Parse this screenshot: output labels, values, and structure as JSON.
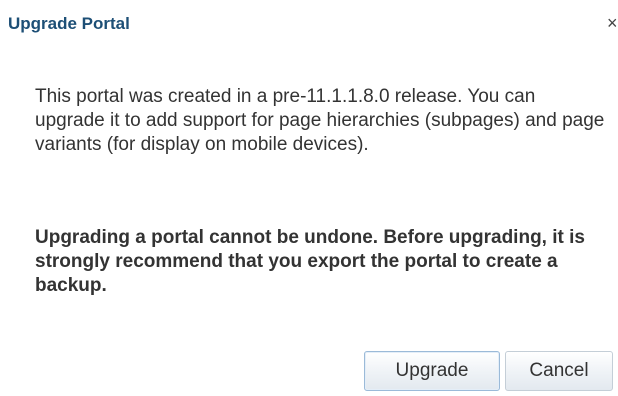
{
  "dialog": {
    "title": "Upgrade Portal",
    "close_glyph": "×",
    "message": "This portal was created in a pre-11.1.1.8.0 release. You can upgrade it to add support for page hierarchies (subpages) and page variants (for display on mobile devices).",
    "warning": "Upgrading a portal cannot be undone. Before upgrading, it is strongly recommend that you export the portal to create a backup.",
    "buttons": {
      "upgrade_label": "Upgrade",
      "cancel_label": "Cancel"
    }
  },
  "colors": {
    "title": "#1d4f76",
    "text": "#333333",
    "button_border": "#c4ced7",
    "default_button_border": "#9bbad8"
  },
  "icons": {
    "close": "close-icon"
  }
}
